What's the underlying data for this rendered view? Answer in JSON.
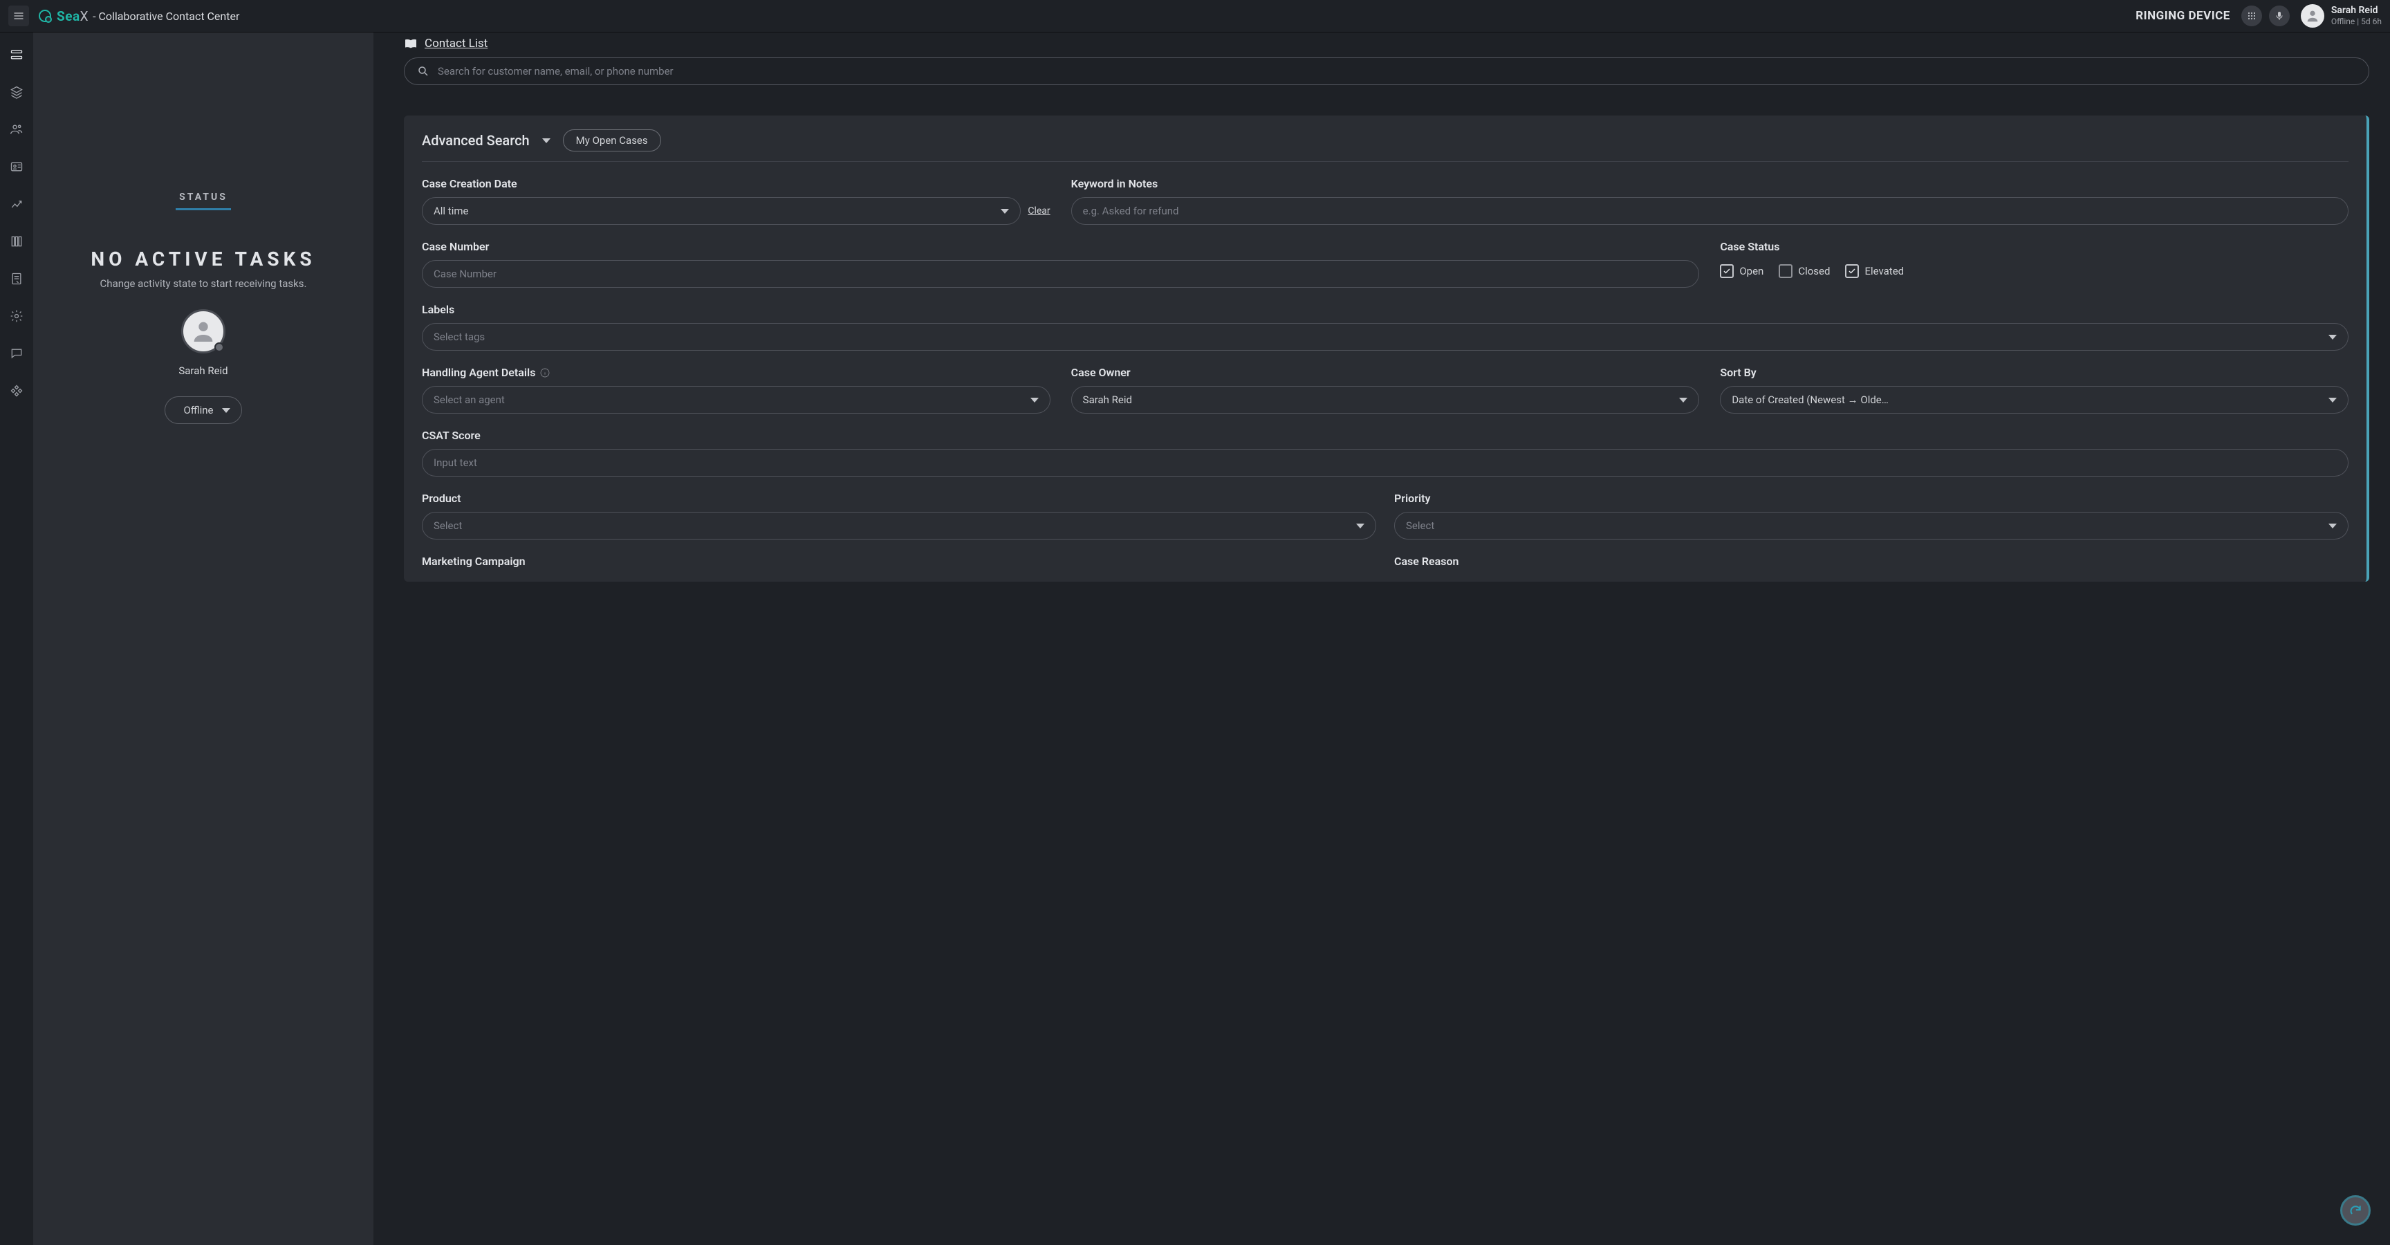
{
  "brand": {
    "name_main": "Sea",
    "name_x": "X",
    "subtitle": "- Collaborative Contact Center"
  },
  "topbar": {
    "ringing": "RINGING DEVICE",
    "user_name": "Sarah Reid",
    "user_status": "Offline  |  5d 6h"
  },
  "status_pane": {
    "label": "STATUS",
    "headline": "NO ACTIVE TASKS",
    "hint": "Change activity state to start receiving tasks.",
    "agent_name": "Sarah Reid",
    "offline": "Offline"
  },
  "main": {
    "contact_list": "Contact List",
    "search_placeholder": "Search for customer name, email, or phone number",
    "advanced_search": "Advanced Search",
    "my_open_cases": "My Open Cases",
    "labels": {
      "creation_date": "Case Creation Date",
      "keyword": "Keyword in Notes",
      "case_number": "Case Number",
      "case_status": "Case Status",
      "labels_field": "Labels",
      "handling_agent": "Handling Agent Details",
      "case_owner": "Case Owner",
      "sort_by": "Sort By",
      "csat": "CSAT Score",
      "product": "Product",
      "priority": "Priority",
      "marketing": "Marketing Campaign",
      "case_reason": "Case Reason"
    },
    "values": {
      "all_time": "All time",
      "clear": "Clear",
      "keyword_ph": "e.g. Asked for refund",
      "case_number_ph": "Case Number",
      "labels_ph": "Select tags",
      "agent_ph": "Select an agent",
      "owner": "Sarah Reid",
      "sort": "Date of Created (Newest → Olde…",
      "csat_ph": "Input text",
      "select_ph": "Select"
    },
    "status_checks": {
      "open": "Open",
      "closed": "Closed",
      "elevated": "Elevated"
    }
  }
}
